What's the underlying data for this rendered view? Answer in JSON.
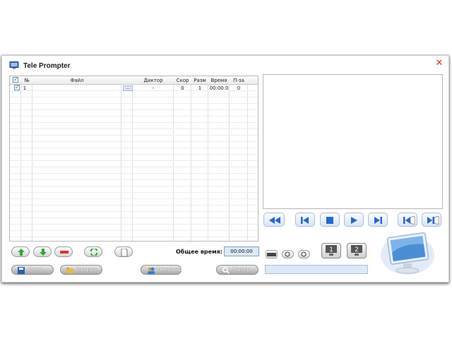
{
  "window": {
    "title": "Tele Prompter"
  },
  "table": {
    "headers": {
      "num": "№",
      "file": "Файл",
      "speaker": "Диктор",
      "speed": "Скор",
      "size": "Разм",
      "time": "Время",
      "pause": "П-за"
    },
    "rows": [
      {
        "num": "1",
        "file": "",
        "browse": "...",
        "speaker": "-",
        "speed": "0",
        "size": "1",
        "time": "00:00.0",
        "pause": "0",
        "checked": true
      }
    ]
  },
  "total": {
    "label": "Общее время:",
    "value": "00:00:00"
  },
  "buttons": {
    "save": "Сохр.",
    "load": "Загруз",
    "speakers": "Дикторы",
    "settings": "Настр"
  },
  "icons": {
    "move_up": "arrow-up-icon",
    "move_down": "arrow-down-icon",
    "delete": "minus-icon",
    "refresh": "refresh-icon",
    "new": "page-icon",
    "rewind": "rewind-icon",
    "prev": "skip-back-icon",
    "stop": "stop-icon",
    "play": "play-icon",
    "next": "skip-forward-icon",
    "book_back": "book-back-icon",
    "book_forward": "book-forward-icon",
    "monitor1": "monitor-1-icon",
    "monitor2": "monitor-2-icon"
  },
  "colors": {
    "accent": "#3a7bd5",
    "close": "#d9362b",
    "field_bg": "#dce9f7"
  }
}
